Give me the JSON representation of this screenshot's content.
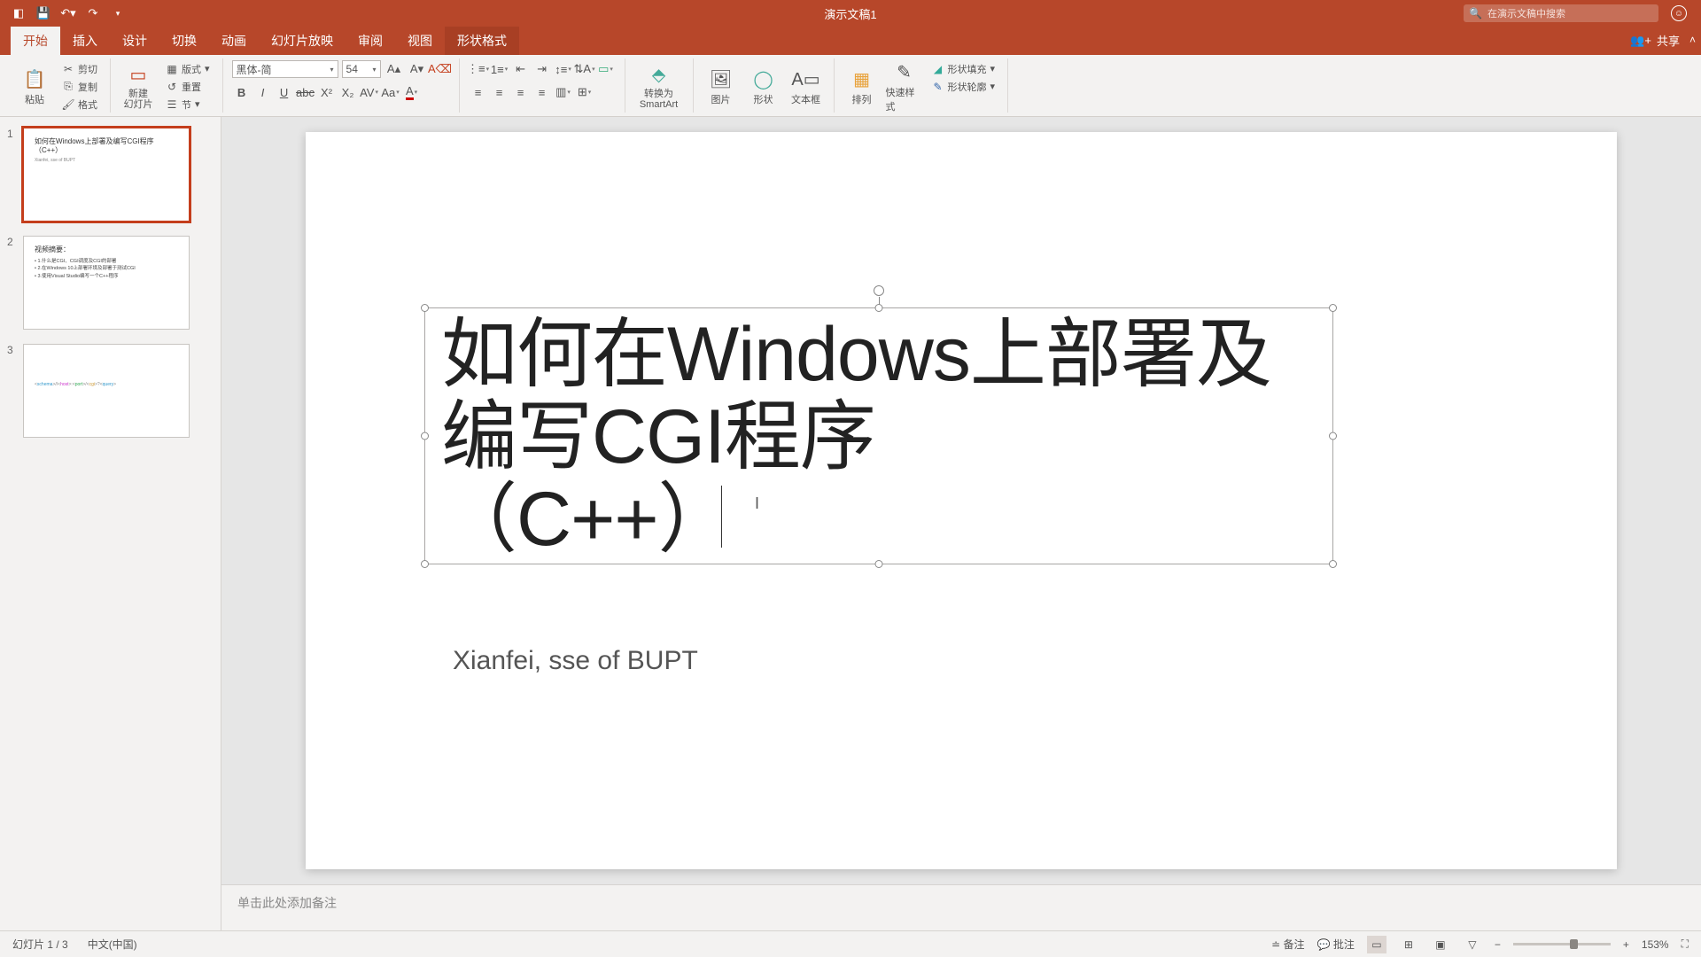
{
  "title_bar": {
    "doc_title": "演示文稿1",
    "search_placeholder": "在演示文稿中搜索"
  },
  "tabs": {
    "items": [
      "开始",
      "插入",
      "设计",
      "切换",
      "动画",
      "幻灯片放映",
      "审阅",
      "视图",
      "形状格式"
    ],
    "share": "共享"
  },
  "ribbon": {
    "clipboard": {
      "paste": "粘贴",
      "cut": "剪切",
      "copy": "复制",
      "format": "格式"
    },
    "slides": {
      "new": "新建\n幻灯片",
      "layout": "版式",
      "reset": "重置",
      "section": "节"
    },
    "font": {
      "name": "黑体-简",
      "size": "54"
    },
    "convert": "转换为\nSmartArt",
    "picture": "图片",
    "shapes": "形状",
    "textbox": "文本框",
    "arrange": "排列",
    "quickstyles": "快速样式",
    "shape_fill": "形状填充",
    "shape_outline": "形状轮廓"
  },
  "thumbs": [
    {
      "num": "1",
      "title": "如何在Windows上部署及编写CGI程序\n（C++）",
      "sub": "Xianfei, sse of BUPT"
    },
    {
      "num": "2",
      "title": "视频摘要：",
      "bullets": "• 1.什么是CGI、CGI调度及CGI的部署\n• 2.在Windows 10上部署环境及部署于测试CGI\n• 3.使用Visual Studio编写一个C++程序"
    },
    {
      "num": "3",
      "colorful": true
    }
  ],
  "slide": {
    "title_lines": [
      "如何在Windows上部署及",
      "编写CGI程序",
      "（C++）"
    ],
    "subtitle": "Xianfei, sse of BUPT"
  },
  "notes": {
    "placeholder": "单击此处添加备注"
  },
  "status": {
    "slide_info": "幻灯片 1 / 3",
    "language": "中文(中国)",
    "notes_btn": "备注",
    "comments_btn": "批注",
    "zoom": "153%"
  }
}
